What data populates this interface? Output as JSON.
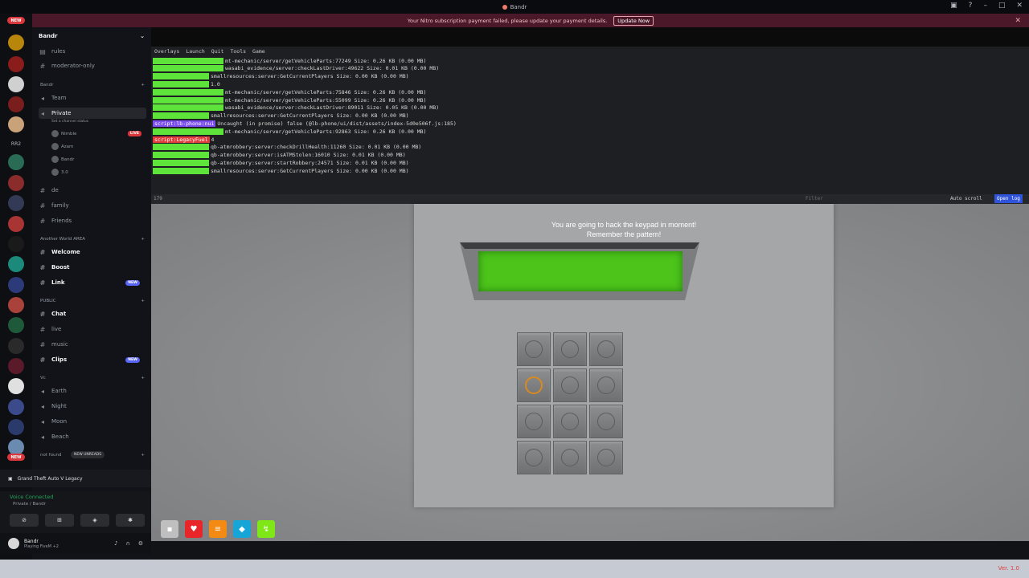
{
  "window": {
    "title": "Bandr"
  },
  "notice": {
    "text": "Your Nitro subscription payment failed, please update your payment details.",
    "button": "Update Now"
  },
  "server_rail": {
    "new_label": "NEW",
    "rr2_label": "RR2"
  },
  "guild": {
    "name": "Bandr",
    "channels_top": [
      "rules",
      "moderator-only"
    ],
    "category_bandr": "Bandr",
    "team": "Team",
    "private": "Private",
    "private_status": "Set a channel status",
    "voice_users": [
      "Nimble",
      "Azam",
      "Bandr",
      "3.0"
    ],
    "live": "LIVE",
    "misc_channels": [
      "de",
      "family",
      "Friends"
    ],
    "category_another": "Another World AREA",
    "another_channels": [
      "Welcome",
      "Boost",
      "Link"
    ],
    "category_public": "PUBLIC",
    "public_channels": [
      "Chat",
      "live",
      "music",
      "Clips"
    ],
    "category_vc": "Vc",
    "vc_channels": [
      "Earth",
      "Night",
      "Moon",
      "Beach"
    ],
    "not_found": "not found",
    "new_unreads": "NEW UNREADS",
    "new_tag": "NEW"
  },
  "activity": {
    "game": "Grand Theft Auto V Legacy"
  },
  "voice": {
    "status": "Voice Connected",
    "location": "Private / Bandr"
  },
  "user": {
    "name": "Bandr",
    "status": "Playing FiveM +2"
  },
  "console": {
    "menu": [
      "Overlays",
      "Launch",
      "Quit",
      "Tools",
      "Game"
    ],
    "lines": [
      {
        "tag": "",
        "tagType": "green2",
        "text": "mt-mechanic/server/getVehicleParts:77249   Size: 0.26 KB (0.00 MB)"
      },
      {
        "tag": "",
        "tagType": "green2",
        "text": "wasabi_evidence/server:checkLastDriver:49622   Size: 0.01 KB (0.00 MB)"
      },
      {
        "tag": "",
        "tagType": "green",
        "text": "smallresources:server:GetCurrentPlayers   Size: 0.00 KB (0.00 MB)"
      },
      {
        "tag": "",
        "tagType": "green",
        "text": "1.0"
      },
      {
        "tag": "",
        "tagType": "green2",
        "text": "mt-mechanic/server/getVehicleParts:75846   Size: 0.26 KB (0.00 MB)"
      },
      {
        "tag": "",
        "tagType": "green2",
        "text": "mt-mechanic/server/getVehicleParts:55099   Size: 0.26 KB (0.00 MB)"
      },
      {
        "tag": "",
        "tagType": "green2",
        "text": "wasabi_evidence/server:checkLastDriver:89011   Size: 0.05 KB (0.00 MB)"
      },
      {
        "tag": "",
        "tagType": "green",
        "text": "smallresources:server:GetCurrentPlayers   Size: 0.00 KB (0.00 MB)"
      },
      {
        "tag": "script:lb-phone:nui",
        "tagType": "purple",
        "text": "Uncaught (in promise) false (@lb-phone/ui/dist/assets/index-5d0e506f.js:185)"
      },
      {
        "tag": "",
        "tagType": "green2",
        "text": "mt-mechanic/server/getVehicleParts:92863   Size: 0.26 KB (0.00 MB)"
      },
      {
        "tag": "script:LegacyFuel",
        "tagType": "red",
        "text": "4"
      },
      {
        "tag": "",
        "tagType": "green",
        "text": "qb-atmrobbery:server:checkDrillHealth:11260   Size: 0.01 KB (0.00 MB)"
      },
      {
        "tag": "",
        "tagType": "green",
        "text": "qb-atmrobbery:server:isATMStolen:16010   Size: 0.01 KB (0.00 MB)"
      },
      {
        "tag": "",
        "tagType": "green",
        "text": "qb-atmrobbery:server:startRobbery:24571   Size: 0.01 KB (0.00 MB)"
      },
      {
        "tag": "",
        "tagType": "green",
        "text": "smallresources:server:GetCurrentPlayers   Size: 0.00 KB (0.00 MB)"
      }
    ],
    "count": "179",
    "filter_placeholder": "Filter",
    "auto_scroll": "Auto scroll",
    "open_log": "Open log"
  },
  "minigame": {
    "message_line1": "You are going to hack the keypad in moment!",
    "message_line2": "Remember the pattern!",
    "screen_color": "#4cc41a",
    "active_key_index": 3,
    "key_count": 12
  },
  "hotbar": [
    {
      "icon": "camera-icon",
      "color": "#bfbfbf"
    },
    {
      "icon": "heart-icon",
      "color": "#e8262a"
    },
    {
      "icon": "burger-icon",
      "color": "#f28a13"
    },
    {
      "icon": "water-drop-icon",
      "color": "#17a5d8"
    },
    {
      "icon": "bolt-icon",
      "color": "#7fe617"
    }
  ],
  "version": "Ver. 1.0"
}
